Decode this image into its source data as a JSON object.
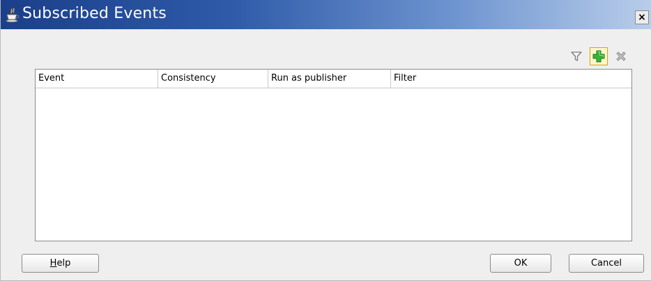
{
  "dialog": {
    "title": "Subscribed Events",
    "close_glyph": "×",
    "title_icon": "java-cup-icon"
  },
  "toolbar": {
    "icons": [
      "filter-icon",
      "add-icon",
      "delete-icon"
    ],
    "accent": "#2aa52a"
  },
  "table": {
    "columns": [
      "Event",
      "Consistency",
      "Run as publisher",
      "Filter"
    ],
    "rows": []
  },
  "buttons": {
    "help_mnemonic": "H",
    "help_rest": "elp",
    "ok": "OK",
    "cancel": "Cancel"
  },
  "colors": {
    "title_bar_dark": "#1b3f8a",
    "title_bar_light": "#b9cdea",
    "dialog_bg": "#efefef"
  }
}
